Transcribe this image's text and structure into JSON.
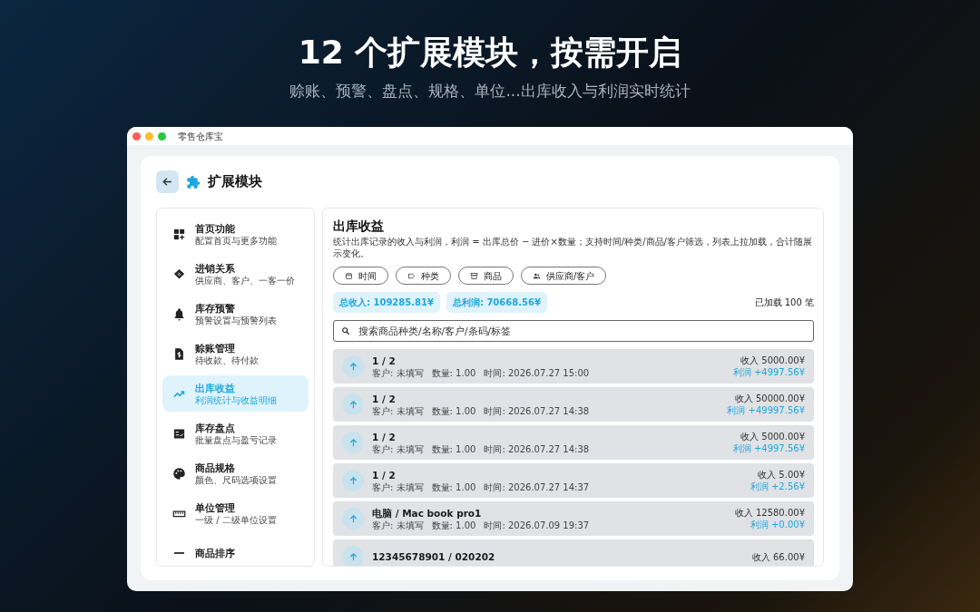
{
  "banner": {
    "title": "12 个扩展模块，按需开启",
    "subtitle": "赊账、预警、盘点、规格、单位...出库收入与利润实时统计"
  },
  "window": {
    "title": "零售仓库宝"
  },
  "page": {
    "title": "扩展模块"
  },
  "sidebar": {
    "items": [
      {
        "title": "首页功能",
        "subtitle": "配置首页与更多功能",
        "selected": false
      },
      {
        "title": "进销关系",
        "subtitle": "供应商、客户、一客一价",
        "selected": false
      },
      {
        "title": "库存预警",
        "subtitle": "预警设置与预警列表",
        "selected": false
      },
      {
        "title": "赊账管理",
        "subtitle": "待收款、待付款",
        "selected": false
      },
      {
        "title": "出库收益",
        "subtitle": "利润统计与收益明细",
        "selected": true
      },
      {
        "title": "库存盘点",
        "subtitle": "批量盘点与盈亏记录",
        "selected": false
      },
      {
        "title": "商品规格",
        "subtitle": "颜色、尺码选项设置",
        "selected": false
      },
      {
        "title": "单位管理",
        "subtitle": "一级 / 二级单位设置",
        "selected": false
      },
      {
        "title": "商品排序",
        "selected": false
      }
    ]
  },
  "panel": {
    "title": "出库收益",
    "description": "统计出库记录的收入与利润，利润 = 出库总价 − 进价×数量；支持时间/种类/商品/客户筛选，列表上拉加载，合计随展示变化。",
    "filters": [
      {
        "label": "时间"
      },
      {
        "label": "种类"
      },
      {
        "label": "商品"
      },
      {
        "label": "供应商/客户"
      }
    ],
    "totals": [
      "总收入: 109285.81¥",
      "总利润: 70668.56¥"
    ],
    "loaded": "已加载 100 笔",
    "search": {
      "placeholder": "搜索商品种类/名称/客户/条码/标签"
    },
    "records": [
      {
        "title": "1 / 2",
        "details": [
          "客户: 未填写",
          "数量: 1.00",
          "时间: 2026.07.27 15:00"
        ],
        "income": "收入 5000.00¥",
        "profit": "利润 +4997.56¥"
      },
      {
        "title": "1 / 2",
        "details": [
          "客户: 未填写",
          "数量: 1.00",
          "时间: 2026.07.27 14:38"
        ],
        "income": "收入 50000.00¥",
        "profit": "利润 +49997.56¥"
      },
      {
        "title": "1 / 2",
        "details": [
          "客户: 未填写",
          "数量: 1.00",
          "时间: 2026.07.27 14:38"
        ],
        "income": "收入 5000.00¥",
        "profit": "利润 +4997.56¥"
      },
      {
        "title": "1 / 2",
        "details": [
          "客户: 未填写",
          "数量: 1.00",
          "时间: 2026.07.27 14:37"
        ],
        "income": "收入 5.00¥",
        "profit": "利润 +2.56¥"
      },
      {
        "title": "电脑 / Mac book pro1",
        "details": [
          "客户: 未填写",
          "数量: 1.00",
          "时间: 2026.07.09 19:37"
        ],
        "income": "收入 12580.00¥",
        "profit": "利润 +0.00¥"
      },
      {
        "title": "12345678901 / 020202",
        "income": "收入 66.00¥"
      }
    ]
  }
}
